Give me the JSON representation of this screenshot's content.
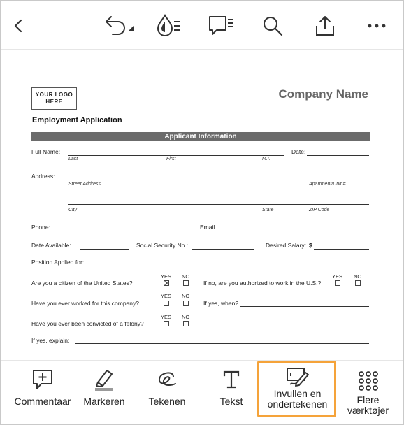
{
  "toolbar": {
    "icons": [
      "back-chevron-icon",
      "undo-icon",
      "fill-drop-icon",
      "comment-list-icon",
      "search-icon",
      "share-icon",
      "more-icon"
    ]
  },
  "document": {
    "logo_text": "YOUR LOGO HERE",
    "company_name": "Company Name",
    "form_title": "Employment Application",
    "section_title": "Applicant Information",
    "fields": {
      "full_name": "Full Name:",
      "date": "Date:",
      "last": "Last",
      "first": "First",
      "mi": "M.I.",
      "address": "Address:",
      "street": "Street Address",
      "apartment": "Apartment/Unit #",
      "city": "City",
      "state": "State",
      "zip": "ZIP Code",
      "phone": "Phone:",
      "email": "Email",
      "date_available": "Date Available:",
      "ssn": "Social Security No.:",
      "desired_salary": "Desired Salary:",
      "salary_symbol": "$",
      "position": "Position Applied for:"
    },
    "questions": {
      "citizen": "Are you a citizen of the United States?",
      "authorized": "If no, are you authorized to work in the U.S.?",
      "worked_before": "Have you ever worked for this company?",
      "if_yes_when": "If yes, when?",
      "felony": "Have you ever been convicted of a felony?",
      "if_yes_explain": "If yes, explain:"
    },
    "yes_label": "YES",
    "no_label": "NO",
    "citizen_answer": "YES"
  },
  "bottom_toolbar": {
    "items": [
      {
        "label": "Commentaar",
        "icon": "comment-add-icon"
      },
      {
        "label": "Markeren",
        "icon": "highlighter-icon"
      },
      {
        "label": "Tekenen",
        "icon": "draw-icon"
      },
      {
        "label": "Tekst",
        "icon": "text-icon"
      },
      {
        "label": "Invullen en ondertekenen",
        "icon": "fill-sign-icon"
      },
      {
        "label": "Flere værktøjer",
        "icon": "grid-icon"
      }
    ],
    "highlight_color": "#f5a33a"
  }
}
